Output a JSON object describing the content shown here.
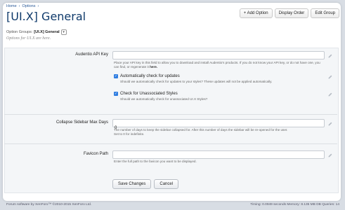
{
  "breadcrumb": {
    "items": [
      "Home",
      "Options"
    ]
  },
  "page": {
    "title": "[UI.X] General"
  },
  "top_actions": {
    "add_option": "+ Add Option",
    "display_order": "Display Order",
    "edit_group": "Edit Group"
  },
  "option_groups": {
    "label": "Option Groups:",
    "value": "[UI.X] General"
  },
  "group_description": "Options for UI.X are here.",
  "fields": {
    "api_key": {
      "label": "Audentio API Key",
      "value": "",
      "help_prefix": "Place your API key in this field to allow you to download and install Audentio's products. If you do not know your API key, or do not have one, you can find, or regenerate it",
      "help_link": "here."
    },
    "auto_check": {
      "label": "Automatically check for updates",
      "checked": true,
      "help": "Should we automatically check for updates to your styles? These updates will not be applied automatically."
    },
    "unassociated": {
      "label": "Check for Unassociated Styles",
      "checked": true,
      "help": "Should we automatically check for unassociated UI.X Styles?"
    },
    "collapse_days": {
      "label": "Collapse Sidebar Max Days",
      "value": "0",
      "help_line1": "The number of days to keep the sidebar collapsed for. After this number of days the sidebar will be re-opened for the user.",
      "help_line2": "Set to 0 for indefinite."
    },
    "favicon": {
      "label": "Favicon Path",
      "value": "",
      "help": "Enter the full path to the favicon you want to be displayed."
    }
  },
  "buttons": {
    "save": "Save Changes",
    "cancel": "Cancel"
  },
  "footer": {
    "left": "Forum software by XenForo™ ©2010-2015 XenForo Ltd.",
    "right": "Timing: 0.0949 seconds Memory: 8.135 MB DB Queries: 14"
  },
  "colors": {
    "title": "#0f3a6b",
    "link": "#2b5a99",
    "checkbox": "#2f7de1"
  }
}
